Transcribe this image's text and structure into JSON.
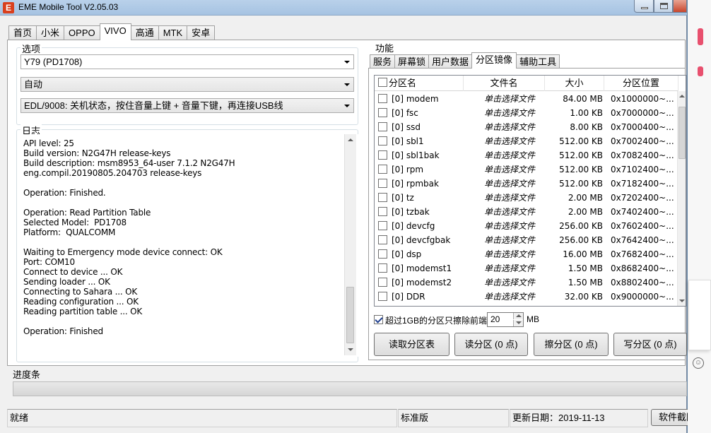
{
  "window": {
    "title": "EME Mobile Tool V2.05.03",
    "icon": "app-logo-icon"
  },
  "main_tabs": [
    "首页",
    "小米",
    "OPPO",
    "VIVO",
    "高通",
    "MTK",
    "安卓"
  ],
  "active_main_tab": "VIVO",
  "options": {
    "title": "选项",
    "model": "Y79 (PD1708)",
    "mode": "自动",
    "edl": "EDL/9008: 关机状态，按住音量上键 + 音量下键，再连接USB线"
  },
  "log": {
    "title": "日志",
    "lines": [
      "API level: 25",
      "Build version: N2G47H release-keys",
      "Build description: msm8953_64-user 7.1.2 N2G47H eng.compil.20190805.204703 release-keys",
      "",
      "Operation: Finished.",
      "",
      "Operation: Read Partition Table",
      "Selected Model:  PD1708",
      "Platform:  QUALCOMM",
      "",
      "Waiting to Emergency mode device connect: OK",
      "Port: COM10",
      "Connect to device ... OK",
      "Sending loader ... OK",
      "Connecting to Sahara ... OK",
      "Reading configuration ... OK",
      "Reading partition table ... OK",
      "",
      "Operation: Finished"
    ]
  },
  "function": {
    "title": "功能",
    "tabs": [
      "服务",
      "屏幕锁",
      "用户数据",
      "分区镜像",
      "辅助工具"
    ],
    "active_tab": "分区镜像"
  },
  "partition_table": {
    "columns": [
      "分区名",
      "文件名",
      "大小",
      "分区位置"
    ],
    "rows": [
      {
        "name": "[0] modem",
        "file": "单击选择文件",
        "size": "84.00 MB",
        "addr": "0x1000000~..."
      },
      {
        "name": "[0] fsc",
        "file": "单击选择文件",
        "size": "1.00 KB",
        "addr": "0x7000000~..."
      },
      {
        "name": "[0] ssd",
        "file": "单击选择文件",
        "size": "8.00 KB",
        "addr": "0x7000400~..."
      },
      {
        "name": "[0] sbl1",
        "file": "单击选择文件",
        "size": "512.00 KB",
        "addr": "0x7002400~..."
      },
      {
        "name": "[0] sbl1bak",
        "file": "单击选择文件",
        "size": "512.00 KB",
        "addr": "0x7082400~..."
      },
      {
        "name": "[0] rpm",
        "file": "单击选择文件",
        "size": "512.00 KB",
        "addr": "0x7102400~..."
      },
      {
        "name": "[0] rpmbak",
        "file": "单击选择文件",
        "size": "512.00 KB",
        "addr": "0x7182400~..."
      },
      {
        "name": "[0] tz",
        "file": "单击选择文件",
        "size": "2.00 MB",
        "addr": "0x7202400~..."
      },
      {
        "name": "[0] tzbak",
        "file": "单击选择文件",
        "size": "2.00 MB",
        "addr": "0x7402400~..."
      },
      {
        "name": "[0] devcfg",
        "file": "单击选择文件",
        "size": "256.00 KB",
        "addr": "0x7602400~..."
      },
      {
        "name": "[0] devcfgbak",
        "file": "单击选择文件",
        "size": "256.00 KB",
        "addr": "0x7642400~..."
      },
      {
        "name": "[0] dsp",
        "file": "单击选择文件",
        "size": "16.00 MB",
        "addr": "0x7682400~..."
      },
      {
        "name": "[0] modemst1",
        "file": "单击选择文件",
        "size": "1.50 MB",
        "addr": "0x8682400~..."
      },
      {
        "name": "[0] modemst2",
        "file": "单击选择文件",
        "size": "1.50 MB",
        "addr": "0x8802400~..."
      },
      {
        "name": "[0] DDR",
        "file": "单击选择文件",
        "size": "32.00 KB",
        "addr": "0x9000000~..."
      }
    ]
  },
  "erase": {
    "label": "超过1GB的分区只擦除前端",
    "value": "20",
    "unit": "MB",
    "checked": true
  },
  "buttons": {
    "read_partition": "读取分区表",
    "read": "读分区 (0 点)",
    "erase": "擦分区 (0 点)",
    "write": "写分区 (0 点)"
  },
  "progress": {
    "title": "进度条",
    "value": 0
  },
  "status": {
    "state": "就绪",
    "edition": "标准版",
    "update_date": "更新日期：2019-11-13",
    "screenshot_button": "软件截图"
  }
}
